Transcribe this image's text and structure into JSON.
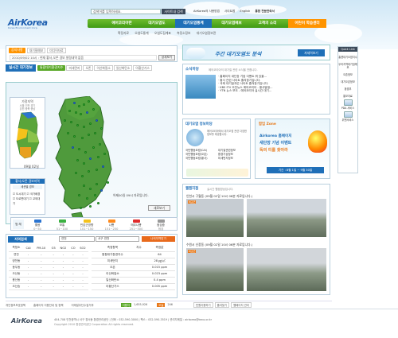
{
  "header": {
    "logo_text": "AirKorea",
    "logo_sub": "Korea Environment Corp.",
    "search_placeholder": "검색어를 입력하세요.",
    "search_button": "사이트내 검색",
    "util_links": [
      "AirKorea의 사용방법",
      "사이트맵",
      "English",
      "통합 천문관측서"
    ]
  },
  "gnb": {
    "items": [
      "에어코리아란",
      "대기오염도",
      "대기오염통계",
      "대기오염예보",
      "고객의 소리",
      "어린이 학습센터"
    ],
    "active_index": 2
  },
  "subnav": [
    "확정자료",
    "오염도통계",
    "오염도집계표",
    "측정소정보",
    "대기오염정보관"
  ],
  "notice": {
    "tabs": [
      "공지사항",
      "대기질예보",
      "미디어자료"
    ],
    "text": "2010/09/02 10시 : 현재 황사,오존 경보 발령내역 없음",
    "detail_button": "상세보기"
  },
  "realtime": {
    "title": "실시간 대기정보",
    "tabs": [
      "통합대기환경지수",
      "미세먼지",
      "오존",
      "이산화질소",
      "일산화탄소",
      "아황산가스"
    ],
    "mini_title": "가정지역",
    "mini_regions": [
      "서울",
      "인천",
      "경기",
      "강원",
      "충북",
      "충남"
    ],
    "time_label": "09월 02일",
    "update_note": "어제00일 09시 자료입니다.",
    "refresh": "새로보기",
    "alert_title": "황사/오존 경보지역",
    "alert_sub": "세션별 경보",
    "alert_items": [
      {
        "label": "도시대기",
        "checked": true
      },
      {
        "label": "국가배경",
        "checked": true
      },
      {
        "label": "도로변대기",
        "checked": true
      },
      {
        "label": "교외대기",
        "checked": true
      }
    ],
    "legend_labels": [
      "좋음",
      "보통",
      "민감군영향",
      "나쁨",
      "매우나쁨",
      "점검중"
    ],
    "legend_ranges": [
      "0~50",
      "51~100",
      "101~150",
      "151~250",
      "251~500",
      "점검"
    ],
    "legend_colors": [
      "#2b74d0",
      "#3bb041",
      "#f5c21b",
      "#ff8a1c",
      "#e02b2b",
      "#999999"
    ],
    "legend_title": "범 례"
  },
  "area_panel": {
    "title": "지역검색",
    "region_select": "연천",
    "station_select": "서구 연천",
    "my_button": "나의지역받기",
    "cols": [
      "측정소",
      "CAI",
      "PM-10",
      "O3",
      "NO2",
      "CO",
      "SO2"
    ],
    "rows": [
      {
        "name": "연천",
        "vals": [
          "-",
          "-",
          "-",
          "-",
          "-",
          "-"
        ]
      },
      {
        "name": "양천동",
        "vals": [
          "-",
          "-",
          "-",
          "-",
          "-",
          "-"
        ]
      },
      {
        "name": "동두동",
        "vals": [
          "-",
          "-",
          "-",
          "-",
          "-",
          "-"
        ]
      },
      {
        "name": "오산동",
        "vals": [
          "-",
          "-",
          "-",
          "-",
          "-",
          "-"
        ]
      },
      {
        "name": "용산동",
        "vals": [
          "-",
          "-",
          "-",
          "-",
          "-",
          "-"
        ]
      },
      {
        "name": "오산송",
        "vals": [
          "-",
          "-",
          "-",
          "-",
          "-",
          "-"
        ]
      }
    ],
    "right_cols": [
      "측정항목",
      "지수",
      "측정값"
    ],
    "right_rows": [
      {
        "item": "통합대기환경지수",
        "idx": "",
        "val": "64"
      },
      {
        "item": "미세먼지",
        "idx": "",
        "val": "28 ㎍/㎥"
      },
      {
        "item": "오존",
        "idx": "",
        "val": "0.015 ppm"
      },
      {
        "item": "이산화질소",
        "idx": "",
        "val": "0.023 ppm"
      },
      {
        "item": "일산화탄소",
        "idx": "",
        "val": "0.4 ppm"
      },
      {
        "item": "아황산가스",
        "idx": "",
        "val": "0.005 ppm"
      }
    ]
  },
  "banner": {
    "text": "주간 대기오염도 분석",
    "button": "자세히보기"
  },
  "news": {
    "title": "소식마당",
    "subtitle": "에어코리아의 대기질 관련 소식을 전합니다.",
    "items": [
      "홈페이지 새단장 기념 이벤트 뭐 있을...",
      "황사 관련 사이트 즐겨찾기입니다.",
      "국제 대기질개선 사이트 즐겨찾기입니다.",
      "KBS ITV 오전뉴스 에어코리아 - 황사발생...",
      "YTN 뉴스 보도 - 에어코리아 실시간 대기..."
    ]
  },
  "info": {
    "title": "대기오염 정보마당",
    "desc": "에어코리아에서 대기오염 관련 다양한 정보를 제공합니다.",
    "links": [
      "국민행동요령(CAI)",
      "대기질관련정보",
      "국민행동요령(오존)",
      "환경기상정보",
      "국민행동요령(황사)",
      "미세먼지정보"
    ]
  },
  "popup": {
    "title": "팝업 Zone",
    "line1": "Airkorea 홈페이지",
    "line2": "새단장 기념 이벤트",
    "line3": "독의 티를 찾아라",
    "date": "기간 : 8월 1일 ~ 9월 30일"
  },
  "webcam": {
    "title": "웹캠지점",
    "subtitle": "실시간 웹캠영상입니다.",
    "cam1_title": "인천시 구월동 (09월 02일 10시 06분 자료입니다.)",
    "cam2_title": "수원시 신풍동 (09월 02일 10시 06분 자료입니다.)",
    "tag": "비교군"
  },
  "quick": {
    "title": "Quick Link",
    "items": [
      "홍콩대기오염지수",
      "우리지역대기질예보",
      "오존정보",
      "대기오존정보",
      "환경부",
      "통보자료",
      "PDA 서비스",
      "위젯서비스"
    ]
  },
  "bottom": {
    "links": [
      "개인정보보호정책",
      "홈페이지 이용안내 및 정책",
      "이메일무단수집거부"
    ],
    "visit_label": "이용자",
    "visit_count": "1,655,926",
    "today_label": "오늘",
    "today_count": "246",
    "buttons": [
      "민원이용하기",
      "즐겨찾기",
      "웹페이지 관리"
    ],
    "address": "404-708 인천광역시 서구 경서동 환경관리공단 | 전화 : 032-590-3000 | 팩스 : 032-590-3519 | 관리자메일 : airkorea@keco.or.kr",
    "copyright": "Copyright 2010 환경관리공단 Corporation All rights reserved."
  }
}
